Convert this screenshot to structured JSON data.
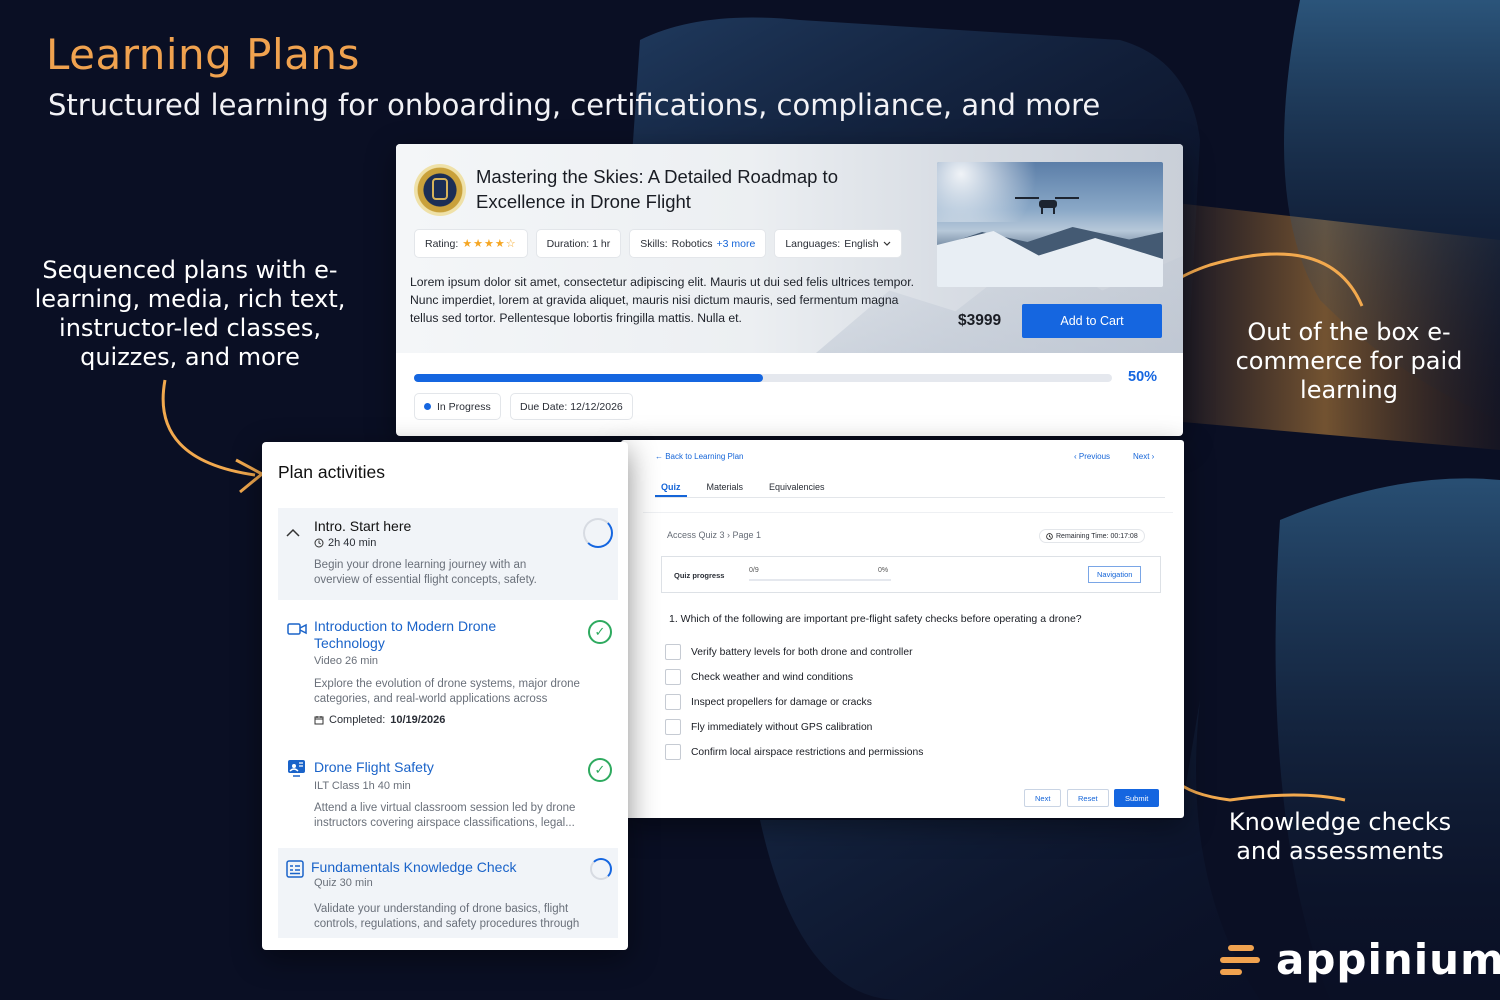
{
  "hero": {
    "title": "Learning Plans",
    "subtitle": "Structured learning for onboarding, certifications, compliance, and more"
  },
  "callouts": {
    "left": "Sequenced plans with e-learning, media, rich text, instructor-led classes, quizzes, and more",
    "right": "Out of the box e-commerce for paid learning",
    "bottom": "Knowledge checks and assessments"
  },
  "course": {
    "title": "Mastering the Skies: A Detailed Roadmap to Excellence in Drone Flight",
    "rating_label": "Rating:",
    "rating_stars": "★★★★☆",
    "rating_value": 4,
    "duration": "Duration: 1 hr",
    "skills_label": "Skills:",
    "skills_value": "Robotics",
    "skills_more": "+3 more",
    "languages_label": "Languages:",
    "languages_value": "English",
    "description": "Lorem ipsum dolor sit amet, consectetur adipiscing elit. Mauris ut dui sed felis ultrices tempor. Nunc imperdiet, lorem at gravida aliquet, mauris nisi dictum mauris, sed fermentum magna tellus sed tortor. Pellentesque lobortis fringilla mattis. Nulla et.",
    "price": "$3999",
    "add_to_cart": "Add to Cart",
    "progress_fraction": 0.5,
    "progress_label": "50%",
    "status": "In Progress",
    "due_date": "Due Date: 12/12/2026",
    "accent_color": "#1566e0"
  },
  "quiz": {
    "back_link": "← Back to Learning Plan",
    "previous": "Previous",
    "next_link": "Next",
    "tabs": [
      "Quiz",
      "Materials",
      "Equivalencies"
    ],
    "breadcrumb": "Access Quiz 3 › Page 1",
    "remaining_time": "Remaining Time: 00:17:08",
    "progress_label": "Quiz progress",
    "progress_fraction": "0/9",
    "progress_percent": "0%",
    "navigation_button": "Navigation",
    "question": "1. Which of the following are important pre-flight safety checks before operating a drone?",
    "options": [
      "Verify battery levels for both drone and controller",
      "Check weather and wind conditions",
      "Inspect propellers for damage or cracks",
      "Fly immediately without GPS calibration",
      "Confirm local airspace restrictions and permissions"
    ],
    "buttons": {
      "next": "Next",
      "reset": "Reset",
      "submit": "Submit"
    }
  },
  "plan": {
    "title": "Plan activities",
    "activities": [
      {
        "title": "Intro. Start here",
        "meta": "2h 40 min",
        "description": "Begin your drone learning journey with an overview of essential flight concepts, safety.",
        "icon": "chevron-up-icon"
      },
      {
        "title": "Introduction to Modern Drone Technology",
        "meta": "Video  26 min",
        "description": "Explore the evolution of drone systems, major drone categories, and real-world applications across",
        "completed_label": "Completed:",
        "completed_date": "10/19/2026",
        "icon": "video-icon"
      },
      {
        "title": "Drone Flight Safety",
        "meta": "ILT Class  1h 40 min",
        "description": "Attend a live virtual classroom session led by drone instructors covering airspace classifications, legal...",
        "icon": "classroom-icon"
      },
      {
        "title": "Fundamentals Knowledge Check",
        "meta": "Quiz  30 min",
        "description": "Validate your understanding of drone basics, flight controls, regulations, and safety procedures through",
        "icon": "quiz-icon"
      }
    ]
  },
  "brand": {
    "name": "appinium",
    "accent": "#f0a24f"
  }
}
